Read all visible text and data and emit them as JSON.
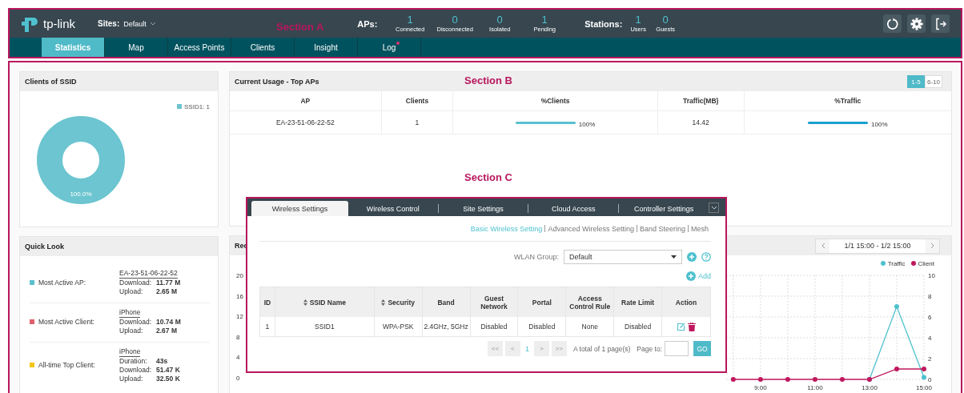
{
  "header": {
    "logo_text": "tp-link",
    "sites_label": "Sites:",
    "site": "Default",
    "aps_label": "APs:",
    "ap_stats": [
      {
        "value": "1",
        "label": "Connected"
      },
      {
        "value": "0",
        "label": "Disconnected"
      },
      {
        "value": "0",
        "label": "Isolated"
      },
      {
        "value": "1",
        "label": "Pending"
      }
    ],
    "stations_label": "Stations:",
    "station_stats": [
      {
        "value": "1",
        "label": "Users"
      },
      {
        "value": "0",
        "label": "Guests"
      }
    ]
  },
  "nav_tabs": [
    {
      "label": "Statistics",
      "selected": true,
      "badge": false
    },
    {
      "label": "Map",
      "selected": false,
      "badge": false
    },
    {
      "label": "Access Points",
      "selected": false,
      "badge": false
    },
    {
      "label": "Clients",
      "selected": false,
      "badge": false
    },
    {
      "label": "Insight",
      "selected": false,
      "badge": false
    },
    {
      "label": "Log",
      "selected": false,
      "badge": true
    }
  ],
  "section_labels": [
    "Section A",
    "Section B",
    "Section C"
  ],
  "clients_of_ssid": {
    "title": "Clients of SSID",
    "legend": [
      {
        "label": "SSID1: 1",
        "color": "#6cc5d0"
      }
    ],
    "ring_label": "100.0%"
  },
  "top_aps": {
    "title": "Current Usage - Top APs",
    "pages": [
      {
        "label": "1-5",
        "selected": true
      },
      {
        "label": "6-10",
        "selected": false
      }
    ],
    "columns": [
      "AP",
      "Clients",
      "%Clients",
      "Traffic(MB)",
      "%Traffic"
    ],
    "rows": [
      {
        "ap": "EA-23-51-06-22-52",
        "clients": "1",
        "clients_share": {
          "level": 1,
          "reading": "100%"
        },
        "traffic": "14.42",
        "traffic_share": {
          "level": 1,
          "reading": "100%"
        }
      }
    ]
  },
  "quick_look": {
    "title": "Quick Look",
    "items": [
      {
        "label": "Most Active AP:",
        "color": "#5bc0cf",
        "device": "EA-23-51-06-22-52",
        "metrics": [
          {
            "name": "Download:",
            "value": "11.77 M"
          },
          {
            "name": "Upload:",
            "value": "2.65 M"
          }
        ]
      },
      {
        "label": "Most Active Client:",
        "color": "#e0606a",
        "device": "iPhone",
        "metrics": [
          {
            "name": "Download:",
            "value": "10.74 M"
          },
          {
            "name": "Upload:",
            "value": "2.67 M"
          }
        ]
      },
      {
        "label": "All-time Top Client:",
        "color": "#f5c518",
        "device": "iPhone",
        "metrics": [
          {
            "name": "Duration:",
            "value": "43s"
          },
          {
            "name": "Download:",
            "value": "51.47 K"
          },
          {
            "name": "Upload:",
            "value": "32.50 K"
          }
        ]
      }
    ]
  },
  "traffic_panel": {
    "title": "Rec",
    "left_ticks": [
      "20",
      "16",
      "12",
      "8",
      "4",
      "0"
    ],
    "range": "1/1 15:00 - 1/2 15:00",
    "chart_data": {
      "type": "line",
      "x": [
        8,
        9,
        10,
        11,
        12,
        13,
        14,
        15
      ],
      "xticks": [
        {
          "value": 9,
          "label": "9:00"
        },
        {
          "value": 11,
          "label": "11:00"
        },
        {
          "value": 13,
          "label": "13:00"
        },
        {
          "value": 15,
          "label": "15:00"
        }
      ],
      "xlim": [
        7.74,
        15
      ],
      "ylim": [
        0,
        10
      ],
      "yticks": [
        0,
        2,
        4,
        6,
        8,
        10
      ],
      "grid": true,
      "legend": "top-right",
      "series": [
        {
          "name": "Traffic",
          "color": "#4fc1ce",
          "marker": "circle",
          "values": [
            null,
            null,
            null,
            null,
            null,
            0,
            7,
            0.2
          ]
        },
        {
          "name": "Client",
          "color": "#c0185e",
          "marker": "circle",
          "values": [
            0,
            0,
            0,
            0,
            0,
            0,
            1,
            1
          ]
        }
      ]
    }
  },
  "settings": {
    "tabs": [
      {
        "label": "Wireless Settings",
        "selected": true
      },
      {
        "label": "Wireless Control",
        "selected": false
      },
      {
        "label": "Site Settings",
        "selected": false
      },
      {
        "label": "Cloud Access",
        "selected": false
      },
      {
        "label": "Controller Settings",
        "selected": false
      }
    ],
    "subtabs": [
      {
        "label": "Basic Wireless Setting",
        "selected": true
      },
      {
        "label": "Advanced Wireless Setting",
        "selected": false
      },
      {
        "label": "Band Steering",
        "selected": false
      },
      {
        "label": "Mesh",
        "selected": false
      }
    ],
    "wlan_group": {
      "label": "WLAN Group:",
      "value": "Default"
    },
    "add_label": "Add",
    "columns": [
      {
        "label": "ID",
        "sortable": false
      },
      {
        "label": "SSID Name",
        "sortable": true
      },
      {
        "label": "Security",
        "sortable": true
      },
      {
        "label": "Band",
        "sortable": false
      },
      {
        "label": "Guest Network",
        "sortable": false
      },
      {
        "label": "Portal",
        "sortable": false
      },
      {
        "label": "Access Control Rule",
        "sortable": false
      },
      {
        "label": "Rate Limit",
        "sortable": false
      },
      {
        "label": "Action",
        "sortable": false
      }
    ],
    "rows": [
      {
        "cells": [
          "1",
          "SSID1",
          "WPA-PSK",
          "2.4GHz, 5GHz",
          "Disabled",
          "Disabled",
          "None",
          "Disabled"
        ]
      }
    ],
    "pagination": {
      "first": "<<",
      "prev": "<",
      "page": "1",
      "next": ">",
      "last": ">>",
      "total": "A total of 1 page(s)",
      "page_to_label": "Page to:",
      "go": "GO"
    }
  }
}
